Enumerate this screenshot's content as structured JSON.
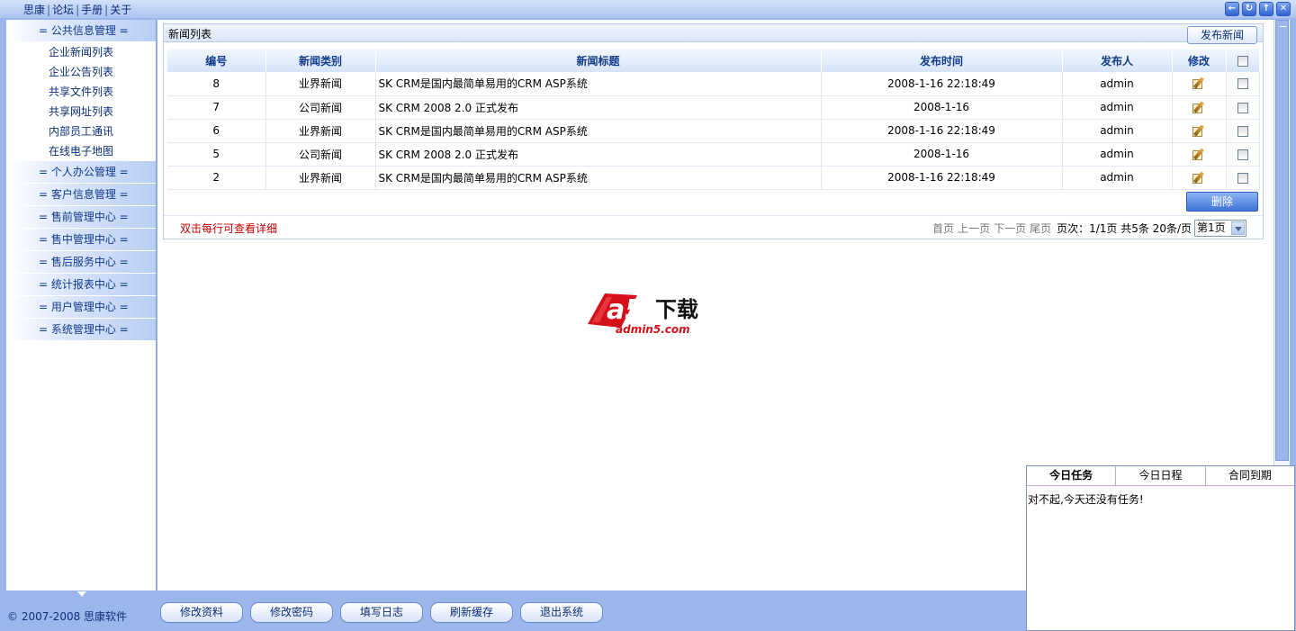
{
  "topnav": {
    "items": [
      "思康",
      "论坛",
      "手册",
      "关于"
    ]
  },
  "window_buttons": [
    "back-icon",
    "refresh-icon",
    "up-icon",
    "close-icon"
  ],
  "sidebar": {
    "groups": [
      {
        "label": "= 公共信息管理  =",
        "items": [
          "企业新闻列表",
          "企业公告列表",
          "共享文件列表",
          "共享网址列表",
          "内部员工通讯",
          "在线电子地图"
        ]
      },
      {
        "label": "= 个人办公管理  ="
      },
      {
        "label": "= 客户信息管理  ="
      },
      {
        "label": "= 售前管理中心  ="
      },
      {
        "label": "= 售中管理中心  ="
      },
      {
        "label": "= 售后服务中心  ="
      },
      {
        "label": "= 统计报表中心  ="
      },
      {
        "label": "= 用户管理中心  ="
      },
      {
        "label": "= 系统管理中心  ="
      }
    ]
  },
  "panel": {
    "title": "新闻列表",
    "publish_button": "发布新闻",
    "columns": [
      "编号",
      "新闻类别",
      "新闻标题",
      "发布时间",
      "发布人",
      "修改"
    ],
    "rows": [
      {
        "id": "8",
        "category": "业界新闻",
        "title": "SK CRM是国内最简单易用的CRM ASP系统",
        "time": "2008-1-16 22:18:49",
        "author": "admin"
      },
      {
        "id": "7",
        "category": "公司新闻",
        "title": "SK CRM 2008 2.0 正式发布",
        "time": "2008-1-16",
        "author": "admin"
      },
      {
        "id": "6",
        "category": "业界新闻",
        "title": "SK CRM是国内最简单易用的CRM ASP系统",
        "time": "2008-1-16 22:18:49",
        "author": "admin"
      },
      {
        "id": "5",
        "category": "公司新闻",
        "title": "SK CRM 2008 2.0 正式发布",
        "time": "2008-1-16",
        "author": "admin"
      },
      {
        "id": "2",
        "category": "业界新闻",
        "title": "SK CRM是国内最简单易用的CRM ASP系统",
        "time": "2008-1-16 22:18:49",
        "author": "admin"
      }
    ],
    "delete_button": "删除",
    "hint": "双击每行可查看详细",
    "pager": {
      "first": "首页",
      "prev": "上一页",
      "next": "下一页",
      "last": "尾页",
      "info": "页次：1/1页 共5条 20条/页",
      "selected_page": "第1页"
    }
  },
  "logo": {
    "big": "下载",
    "url": "admin5.com"
  },
  "footer": {
    "copyright": "© 2007-2008 思康软件",
    "buttons": [
      "修改资料",
      "修改密码",
      "填写日志",
      "刷新缓存",
      "退出系统"
    ]
  },
  "tasks": {
    "tabs": [
      "今日任务",
      "今日日程",
      "合同到期"
    ],
    "active_tab": 0,
    "message": "对不起,今天还没有任务!"
  },
  "colors": {
    "accent": "#9bb6ea",
    "hint_red": "#c00000",
    "header_text": "#143c8c"
  }
}
